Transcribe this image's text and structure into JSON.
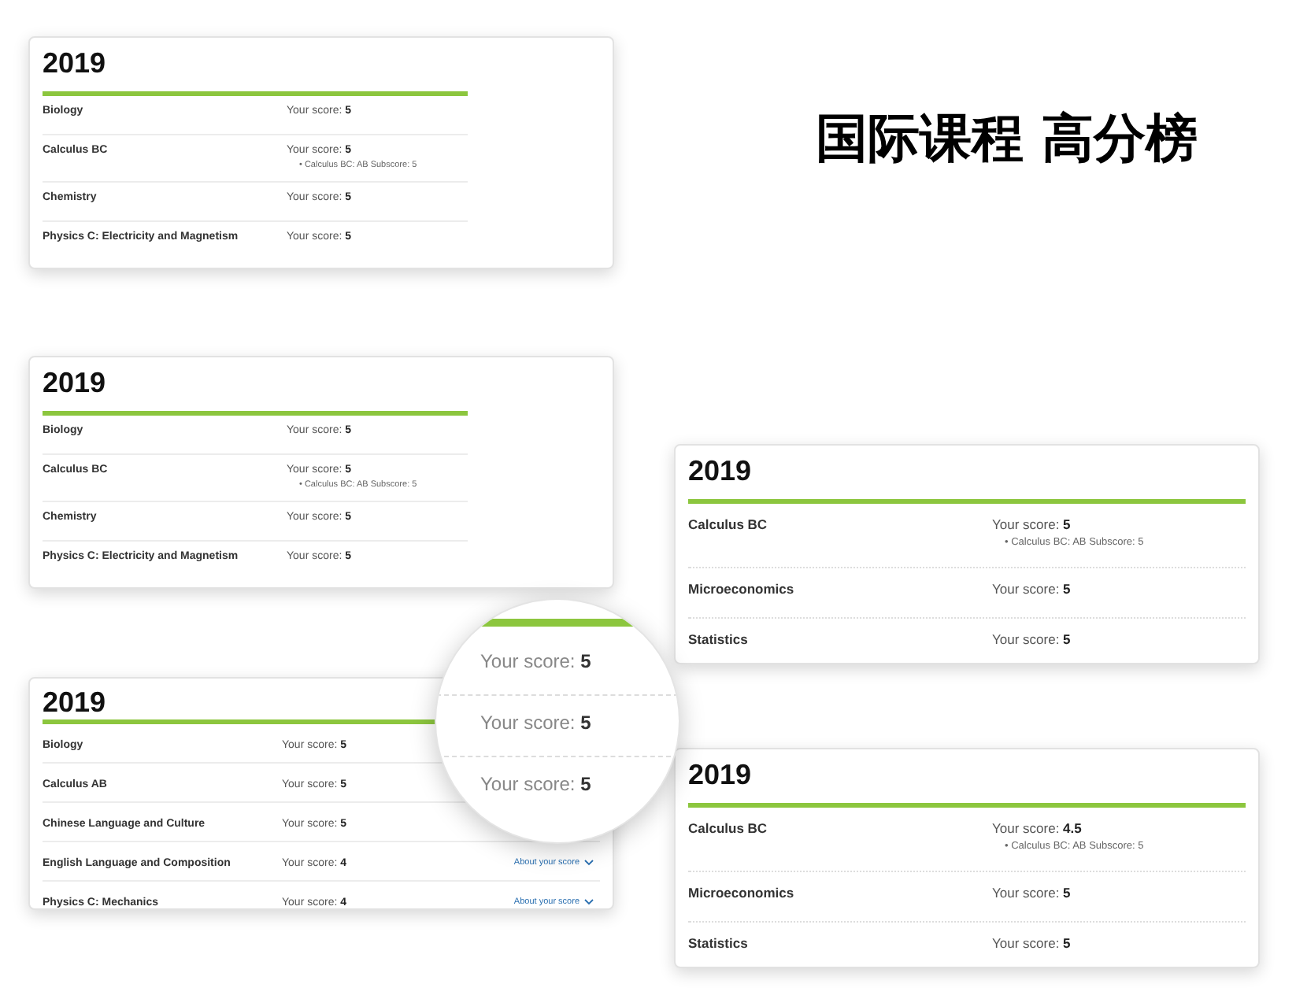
{
  "heading": "国际课程 高分榜",
  "cards": [
    {
      "year": "2019",
      "rows": [
        {
          "subject": "Biology",
          "score": "Your score: **5**"
        },
        {
          "subject": "Calculus BC",
          "score": "Your score: **5**",
          "subscore": "• Calculus BC: AB Subscore: 5"
        },
        {
          "subject": "Chemistry",
          "score": "Your score: **5**"
        },
        {
          "subject": "Physics C: Electricity and Magnetism",
          "score": "Your score: **5**"
        }
      ]
    },
    {
      "year": "2019",
      "rows": [
        {
          "subject": "Biology",
          "score": "Your score: **5**"
        },
        {
          "subject": "Calculus BC",
          "score": "Your score: **5**",
          "subscore": "• Calculus BC: AB Subscore: 5"
        },
        {
          "subject": "Chemistry",
          "score": "Your score: **5**"
        },
        {
          "subject": "Physics C: Electricity and Magnetism",
          "score": "Your score: **5**"
        }
      ]
    },
    {
      "year": "2019",
      "rows": [
        {
          "subject": "Biology",
          "score": "Your score: **5**"
        },
        {
          "subject": "Calculus AB",
          "score": "Your score: **5**"
        },
        {
          "subject": "Chinese Language and Culture",
          "score": "Your score: **5**"
        },
        {
          "subject": "English Language and Composition",
          "score": "Your score: **4**",
          "link": "About your score"
        },
        {
          "subject": "Physics C: Mechanics",
          "score": "Your score: **4**",
          "link": "About your score"
        }
      ]
    },
    {
      "year": "2019",
      "rows": [
        {
          "subject": "Calculus BC",
          "score": "Your score: **5**",
          "subscore": "• Calculus BC: AB Subscore: 5"
        },
        {
          "subject": "Microeconomics",
          "score": "Your score: **5**"
        },
        {
          "subject": "Statistics",
          "score": "Your score: **5**"
        }
      ]
    },
    {
      "year": "2019",
      "rows": [
        {
          "subject": "Calculus BC",
          "score": "Your score: **4.5**",
          "subscore": "• Calculus BC: AB Subscore: 5"
        },
        {
          "subject": "Microeconomics",
          "score": "Your score: **5**"
        },
        {
          "subject": "Statistics",
          "score": "Your score: **5**"
        }
      ]
    }
  ],
  "magnifier": {
    "rows": [
      {
        "score": "Your score: **5**"
      },
      {
        "score": "Your score: **5**"
      },
      {
        "score": "Your score: **5**"
      }
    ]
  }
}
